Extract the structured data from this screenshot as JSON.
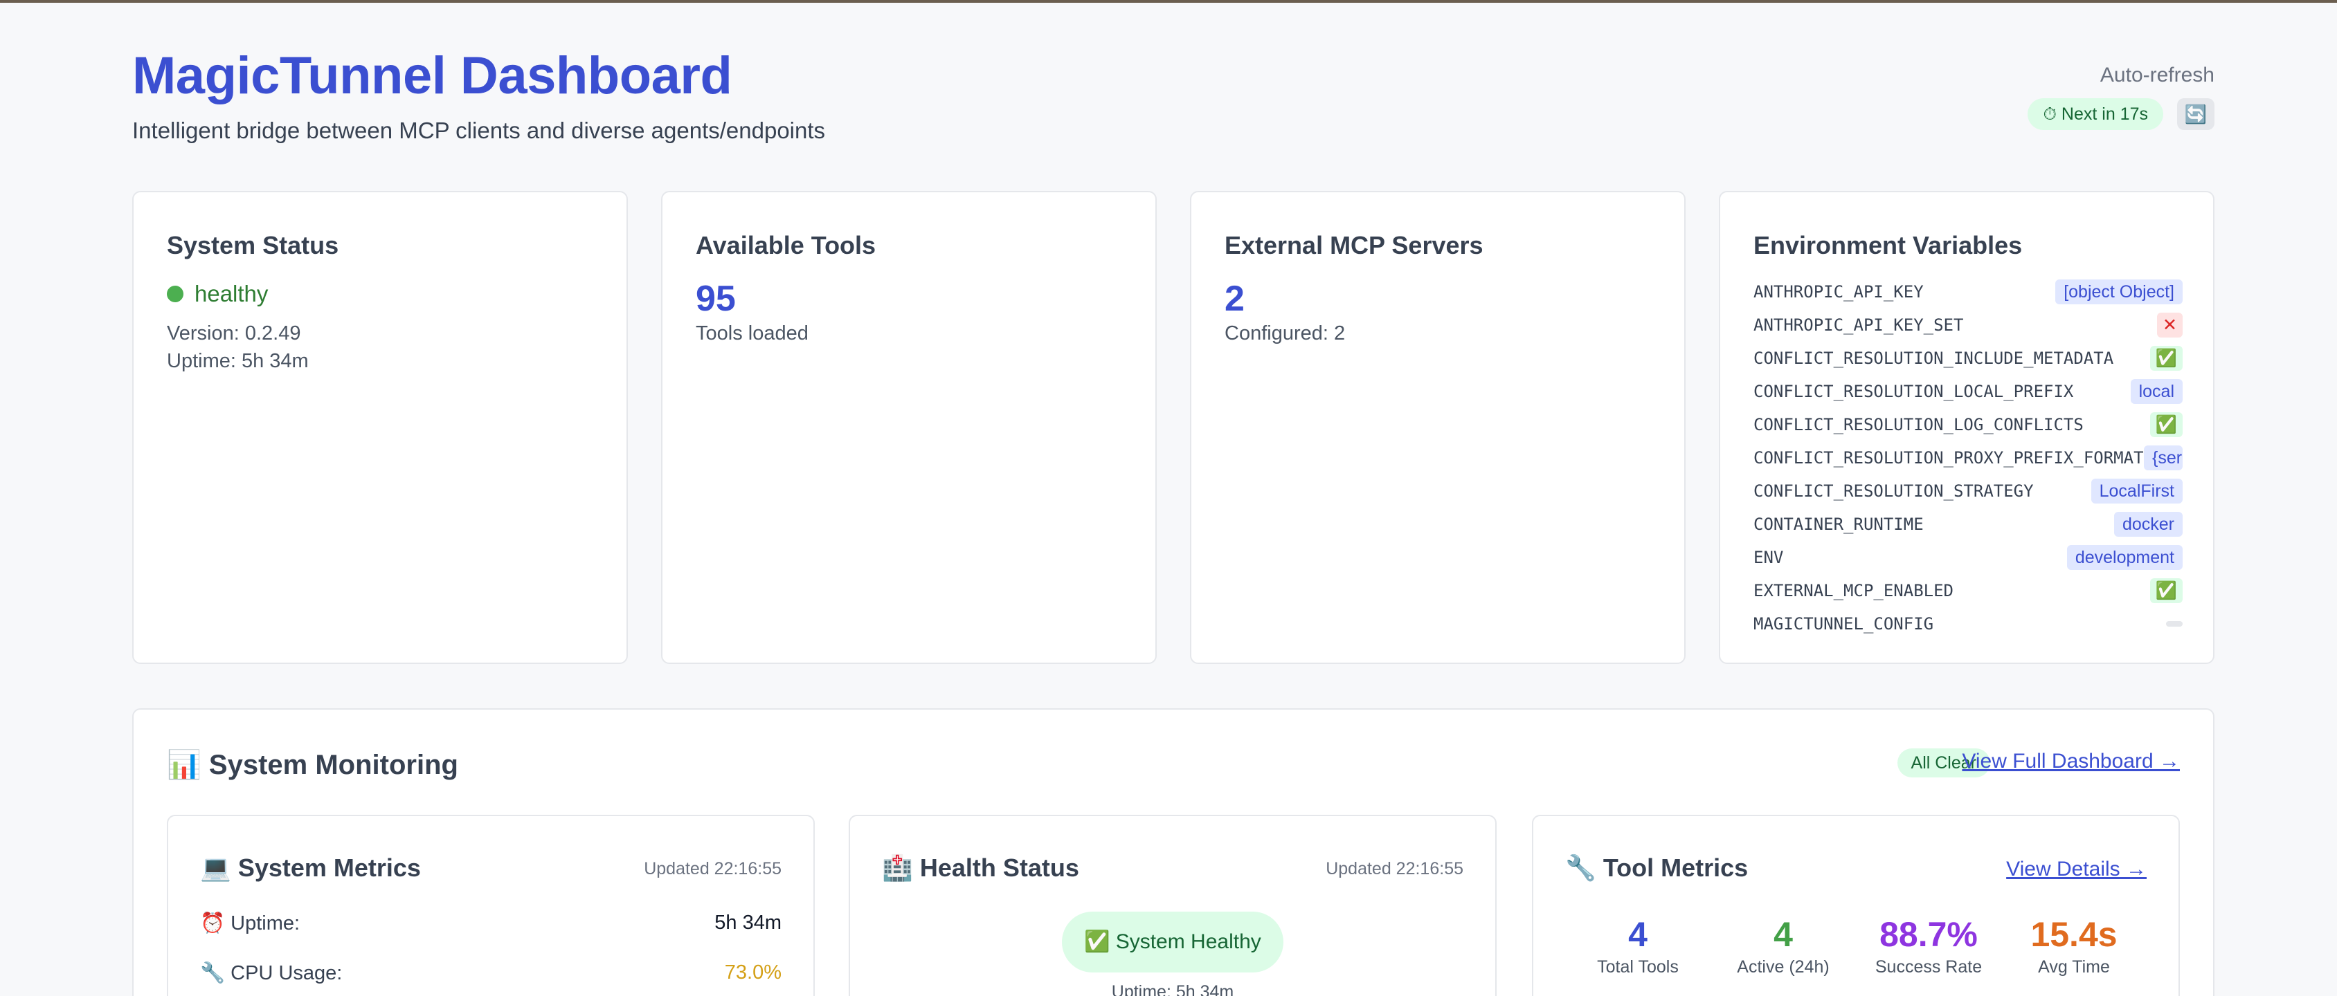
{
  "header": {
    "title": "MagicTunnel Dashboard",
    "subtitle": "Intelligent bridge between MCP clients and diverse agents/endpoints",
    "auto_refresh_label": "Auto-refresh",
    "next_refresh": "⏱ Next in 17s",
    "refresh_button_icon": "🔄"
  },
  "system_status": {
    "title": "System Status",
    "status": "healthy",
    "version": "Version: 0.2.49",
    "uptime": "Uptime: 5h 34m"
  },
  "available_tools": {
    "title": "Available Tools",
    "count": "95",
    "caption": "Tools loaded"
  },
  "external_servers": {
    "title": "External MCP Servers",
    "count": "2",
    "caption": "Configured: 2"
  },
  "env_vars": {
    "title": "Environment Variables",
    "items": [
      {
        "key": "ANTHROPIC_API_KEY",
        "value": "[object Object]"
      },
      {
        "key": "ANTHROPIC_API_KEY_SET",
        "value": "✕"
      },
      {
        "key": "CONFLICT_RESOLUTION_INCLUDE_METADATA",
        "value": "✅"
      },
      {
        "key": "CONFLICT_RESOLUTION_LOCAL_PREFIX",
        "value": "local"
      },
      {
        "key": "CONFLICT_RESOLUTION_LOG_CONFLICTS",
        "value": "✅"
      },
      {
        "key": "CONFLICT_RESOLUTION_PROXY_PREFIX_FORMAT",
        "value": "{ser"
      },
      {
        "key": "CONFLICT_RESOLUTION_STRATEGY",
        "value": "LocalFirst"
      },
      {
        "key": "CONTAINER_RUNTIME",
        "value": "docker"
      },
      {
        "key": "ENV",
        "value": "development"
      },
      {
        "key": "EXTERNAL_MCP_ENABLED",
        "value": "✅"
      },
      {
        "key": "MAGICTUNNEL_CONFIG",
        "value": ""
      }
    ]
  },
  "monitoring": {
    "title": "📊 System Monitoring",
    "all_clear": "All Clear",
    "view_full": "View Full Dashboard →",
    "system_metrics": {
      "title": "💻 System Metrics",
      "updated": "Updated 22:16:55",
      "uptime_label": "⏰ Uptime:",
      "uptime_value": "5h 34m",
      "cpu_label": "🔧 CPU Usage:",
      "cpu_value": "73.0%"
    },
    "health_status": {
      "title": "🏥 Health Status",
      "updated": "Updated 22:16:55",
      "status": "✅ System Healthy",
      "uptime": "Uptime: 5h 34m"
    },
    "tool_metrics": {
      "title": "🔧 Tool Metrics",
      "view_details": "View Details →",
      "total_tools": "4",
      "total_tools_label": "Total Tools",
      "active": "4",
      "active_label": "Active (24h)",
      "success_rate": "88.7%",
      "success_rate_label": "Success Rate",
      "avg_time": "15.4s",
      "avg_time_label": "Avg Time"
    }
  }
}
